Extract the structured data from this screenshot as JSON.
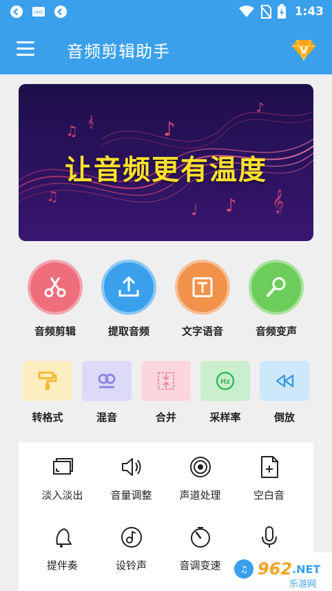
{
  "status_bar": {
    "time": "1:43"
  },
  "app_bar": {
    "title": "音频剪辑助手"
  },
  "banner": {
    "title": "让音频更有温度"
  },
  "main_actions": [
    {
      "label": "音频剪辑",
      "color": "#ee6e7c",
      "icon": "scissors-icon"
    },
    {
      "label": "提取音频",
      "color": "#3aa0ec",
      "icon": "upload-icon"
    },
    {
      "label": "文字语音",
      "color": "#f2914a",
      "icon": "text-box-icon"
    },
    {
      "label": "音频变声",
      "color": "#6dcd5a",
      "icon": "microphone-icon"
    }
  ],
  "secondary_actions": [
    {
      "label": "转格式",
      "bg": "#fdeec0",
      "color": "#f5b731",
      "icon": "paint-roller-icon"
    },
    {
      "label": "混音",
      "bg": "#dcdaf8",
      "color": "#8d86e6",
      "icon": "mix-icon"
    },
    {
      "label": "合并",
      "bg": "#fcd6de",
      "color": "#ef8a9f",
      "icon": "merge-icon"
    },
    {
      "label": "采样率",
      "bg": "#c9efcf",
      "color": "#36b955",
      "icon": "hz-icon"
    },
    {
      "label": "倒放",
      "bg": "#cde8fb",
      "color": "#3c9ce6",
      "icon": "rewind-icon"
    }
  ],
  "tools": [
    {
      "label": "淡入淡出",
      "icon": "fade-icon"
    },
    {
      "label": "音量调整",
      "icon": "volume-icon"
    },
    {
      "label": "声道处理",
      "icon": "channel-icon"
    },
    {
      "label": "空白音",
      "icon": "blank-file-icon"
    },
    {
      "label": "提伴奏",
      "icon": "bell-icon"
    },
    {
      "label": "设铃声",
      "icon": "ringtone-icon"
    },
    {
      "label": "音调变速",
      "icon": "speed-icon"
    },
    {
      "label": "录音",
      "icon": "mic-icon"
    }
  ],
  "watermark": {
    "text": "962.NET",
    "subtext": "乐游网"
  }
}
